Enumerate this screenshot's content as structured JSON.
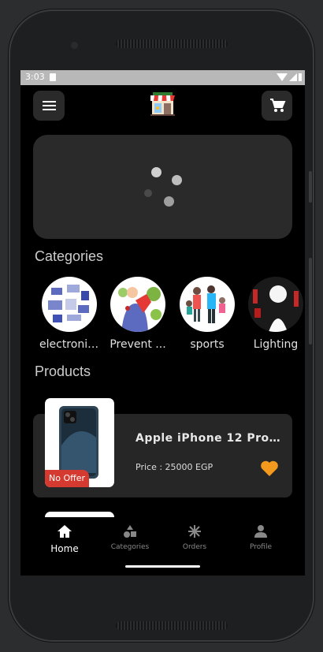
{
  "status_bar": {
    "time": "3:03"
  },
  "header": {
    "menu_icon": "hamburger-menu-icon",
    "logo_icon": "shop-storefront-icon",
    "cart_icon": "shopping-cart-icon"
  },
  "banner": {
    "state": "loading",
    "spinner_icon": "loading-dots-icon"
  },
  "categories": {
    "title": "Categories",
    "items": [
      {
        "label": "electronic ..."
      },
      {
        "label": "Prevent ..."
      },
      {
        "label": "sports"
      },
      {
        "label": "Lighting"
      }
    ]
  },
  "products": {
    "title": "Products",
    "items": [
      {
        "name": "Apple iPhone 12 Pro Ma...",
        "price": "Price : 25000 EGP",
        "badge": "No Offer",
        "favorite_icon": "heart-icon"
      }
    ]
  },
  "bottom_nav": {
    "items": [
      {
        "label": "Home",
        "icon": "home-icon",
        "active": true
      },
      {
        "label": "Categories",
        "icon": "categories-shapes-icon",
        "active": false
      },
      {
        "label": "Orders",
        "icon": "orders-icon",
        "active": false
      },
      {
        "label": "Profile",
        "icon": "person-icon",
        "active": false
      }
    ]
  },
  "colors": {
    "accent": "#f39a1e",
    "badge": "#d43a2f",
    "card": "#262626",
    "background": "#000000"
  }
}
